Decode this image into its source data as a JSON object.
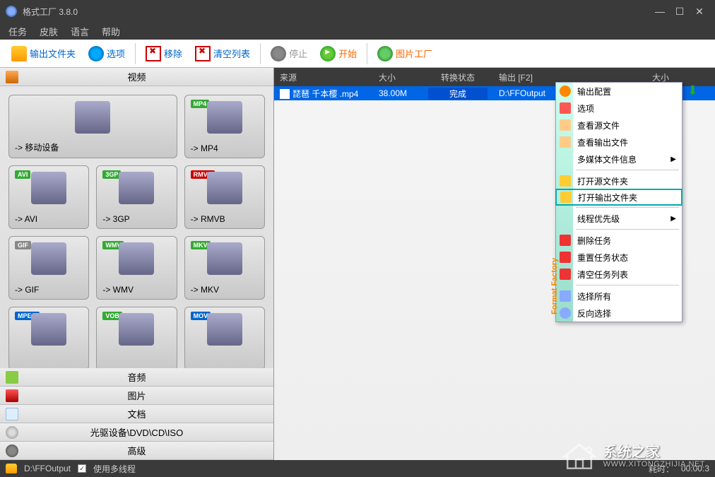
{
  "titlebar": {
    "title": "格式工厂 3.8.0"
  },
  "menubar": {
    "items": [
      "任务",
      "皮肤",
      "语言",
      "帮助"
    ]
  },
  "toolbar": {
    "output_folder": "输出文件夹",
    "options": "选项",
    "remove": "移除",
    "clear": "清空列表",
    "stop": "停止",
    "start": "开始",
    "image_factory": "图片工厂"
  },
  "sidebar": {
    "categories": {
      "video": "视频",
      "audio": "音频",
      "image": "图片",
      "document": "文档",
      "disc": "光驱设备\\DVD\\CD\\ISO",
      "advanced": "高级"
    },
    "formats": [
      {
        "label": "-> 移动设备",
        "tag": "",
        "wide": true
      },
      {
        "label": "-> MP4",
        "tag": "MP4"
      },
      {
        "label": "-> AVI",
        "tag": "AVI"
      },
      {
        "label": "-> 3GP",
        "tag": "3GP"
      },
      {
        "label": "-> RMVB",
        "tag": "RMVB"
      },
      {
        "label": "-> GIF",
        "tag": "GIF"
      },
      {
        "label": "-> WMV",
        "tag": "WMV"
      },
      {
        "label": "-> MKV",
        "tag": "MKV"
      },
      {
        "label": "",
        "tag": "MPEG"
      },
      {
        "label": "",
        "tag": "VOB"
      },
      {
        "label": "",
        "tag": "MOV"
      }
    ]
  },
  "tasklist": {
    "headers": {
      "source": "来源",
      "size": "大小",
      "status": "转换状态",
      "output": "输出 [F2]",
      "outsize": "大小"
    },
    "rows": [
      {
        "file": "琵琶 千本樱 .mp4",
        "size": "38.00M",
        "status": "完成",
        "output": "D:\\FFOutput"
      }
    ]
  },
  "context_menu": {
    "brand": "Format Factory",
    "items": [
      {
        "label": "输出配置",
        "icon": "gear"
      },
      {
        "label": "选项",
        "icon": "options"
      },
      {
        "label": "查看源文件",
        "icon": "file"
      },
      {
        "label": "查看输出文件",
        "icon": "file"
      },
      {
        "label": "多媒体文件信息",
        "icon": "",
        "sub": true
      },
      {
        "sep": true
      },
      {
        "label": "打开源文件夹",
        "icon": "folder"
      },
      {
        "label": "打开输出文件夹",
        "icon": "folder",
        "highlight": true
      },
      {
        "sep": true
      },
      {
        "label": "线程优先级",
        "icon": "",
        "sub": true
      },
      {
        "sep": true
      },
      {
        "label": "删除任务",
        "icon": "del"
      },
      {
        "label": "重置任务状态",
        "icon": "reset"
      },
      {
        "label": "清空任务列表",
        "icon": "clear"
      },
      {
        "sep": true
      },
      {
        "label": "选择所有",
        "icon": "sel"
      },
      {
        "label": "反向选择",
        "icon": "inv"
      }
    ]
  },
  "statusbar": {
    "output_path": "D:\\FFOutput",
    "multithread": "使用多线程",
    "elapsed_label": "耗时：",
    "elapsed": "00:00:3"
  },
  "watermark": {
    "main": "系统之家",
    "sub": "WWW.XITONGZHIJIA.NET"
  }
}
